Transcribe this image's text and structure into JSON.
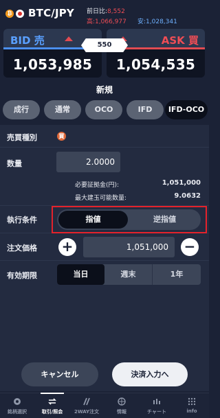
{
  "header": {
    "pair": "BTC/JPY",
    "btc_icon": "₿",
    "change_label": "前日比:",
    "change_value": "8,552",
    "high_label": "高:",
    "high_value": "1,066,977",
    "low_label": "安:",
    "low_value": "1,028,341"
  },
  "quotes": {
    "bid_label": "BID 売",
    "bid_price": "1,053,985",
    "ask_label": "ASK 買",
    "ask_price": "1,054,535",
    "spread": "550"
  },
  "section_title": "新規",
  "order_tabs": [
    "成行",
    "通常",
    "OCO",
    "IFD",
    "IFD-OCO"
  ],
  "form": {
    "side_label": "売買種別",
    "side_badge": "買",
    "qty_label": "数量",
    "qty_value": "2.0000",
    "margin_label": "必要証拠金(円):",
    "margin_value": "1,051,000",
    "max_label": "最大建玉可能数量:",
    "max_value": "9.0632",
    "exec_label": "執行条件",
    "exec_options": [
      "指値",
      "逆指値"
    ],
    "price_label": "注文価格",
    "price_value": "1,051,000",
    "plus": "+",
    "minus": "−",
    "expiry_label": "有効期限",
    "expiry_options": [
      "当日",
      "週末",
      "1年"
    ]
  },
  "buttons": {
    "cancel": "キャンセル",
    "settle": "決済入力へ"
  },
  "nav": [
    "銘柄選択",
    "取引/照会",
    "2WAY注文",
    "情報",
    "チャート",
    "info"
  ]
}
